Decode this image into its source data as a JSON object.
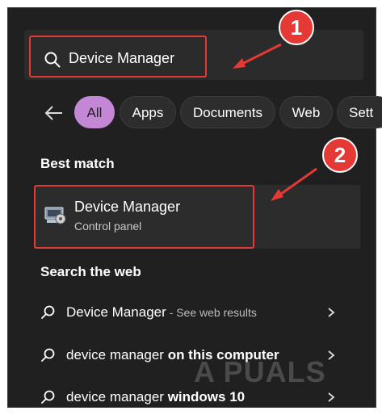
{
  "search": {
    "query": "Device Manager"
  },
  "filters": {
    "back_icon": "back-arrow-icon",
    "items": [
      {
        "label": "All",
        "active": true
      },
      {
        "label": "Apps"
      },
      {
        "label": "Documents"
      },
      {
        "label": "Web"
      },
      {
        "label": "Sett"
      }
    ]
  },
  "best_match": {
    "heading": "Best match",
    "title": "Device Manager",
    "subtitle": "Control panel",
    "icon": "device-manager-icon"
  },
  "web": {
    "heading": "Search the web",
    "results": [
      {
        "text": "Device Manager",
        "suffix": " - See web results"
      },
      {
        "text": "device manager",
        "bold": " on this computer"
      },
      {
        "text": "device manager",
        "bold": " windows 10"
      }
    ]
  },
  "annotations": {
    "step1": "1",
    "step2": "2"
  },
  "watermark": "A PUALS",
  "colors": {
    "highlight": "#e53935",
    "active_chip": "#c487d6",
    "panel_bg": "#202020"
  }
}
